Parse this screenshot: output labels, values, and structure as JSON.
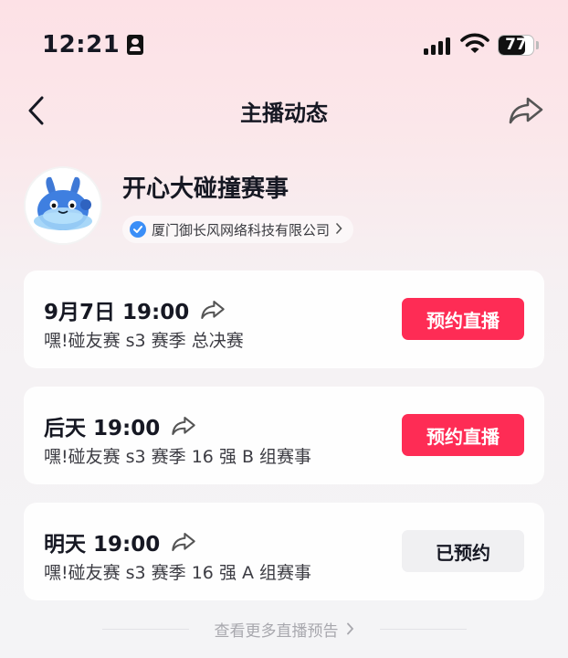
{
  "status_bar": {
    "time": "12:21",
    "battery": "77",
    "battery_level": 0.77
  },
  "nav": {
    "title": "主播动态",
    "back_icon": "chevron-left-icon",
    "share_icon": "share-icon"
  },
  "profile": {
    "name": "开心大碰撞赛事",
    "company": "厦门御长风网络科技有限公司",
    "verified_color": "#3b8ef7"
  },
  "events": [
    {
      "time": "9月7日 19:00",
      "title": "嘿!碰友赛 s3 赛季 总决赛",
      "button": "预约直播",
      "booked": false
    },
    {
      "time": "后天 19:00",
      "title": "嘿!碰友赛 s3 赛季 16 强 B 组赛事",
      "button": "预约直播",
      "booked": false
    },
    {
      "time": "明天 19:00",
      "title": "嘿!碰友赛 s3 赛季 16 强 A 组赛事",
      "button": "已预约",
      "booked": true
    }
  ],
  "footer": {
    "more_label": "查看更多直播预告"
  },
  "colors": {
    "accent": "#fe2c55",
    "text": "#161823"
  }
}
